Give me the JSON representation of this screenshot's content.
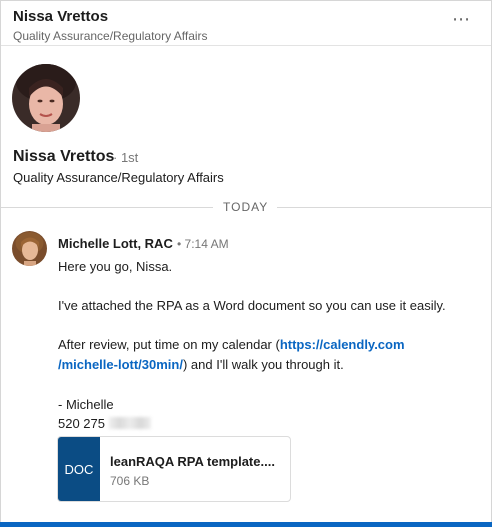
{
  "header": {
    "name": "Nissa Vrettos",
    "title": "Quality Assurance/Regulatory Affairs",
    "more_label": "⋯"
  },
  "profile": {
    "name": "Nissa Vrettos",
    "degree": "· 1st",
    "headline": "Quality Assurance/Regulatory Affairs"
  },
  "divider": {
    "label": "TODAY"
  },
  "message": {
    "sender": "Michelle Lott, RAC",
    "time": "• 7:14 AM",
    "line1": "Here you go, Nissa.",
    "line2": "I've attached the RPA as a Word document so you can use it easily.",
    "line3_pre": "After review, put time on my calendar (",
    "link_part1": "https://calendly.com",
    "link_part2": "/michelle-lott/30min/",
    "line4_post": ") and I'll walk you through it.",
    "signoff": "- Michelle",
    "phone": "520 275"
  },
  "attachment": {
    "badge": "DOC",
    "filename": "leanRAQA RPA template....",
    "size": "706 KB"
  },
  "colors": {
    "link": "#0a66c2",
    "doc_badge": "#0b4c84",
    "accent_bar": "#0a66c2"
  }
}
